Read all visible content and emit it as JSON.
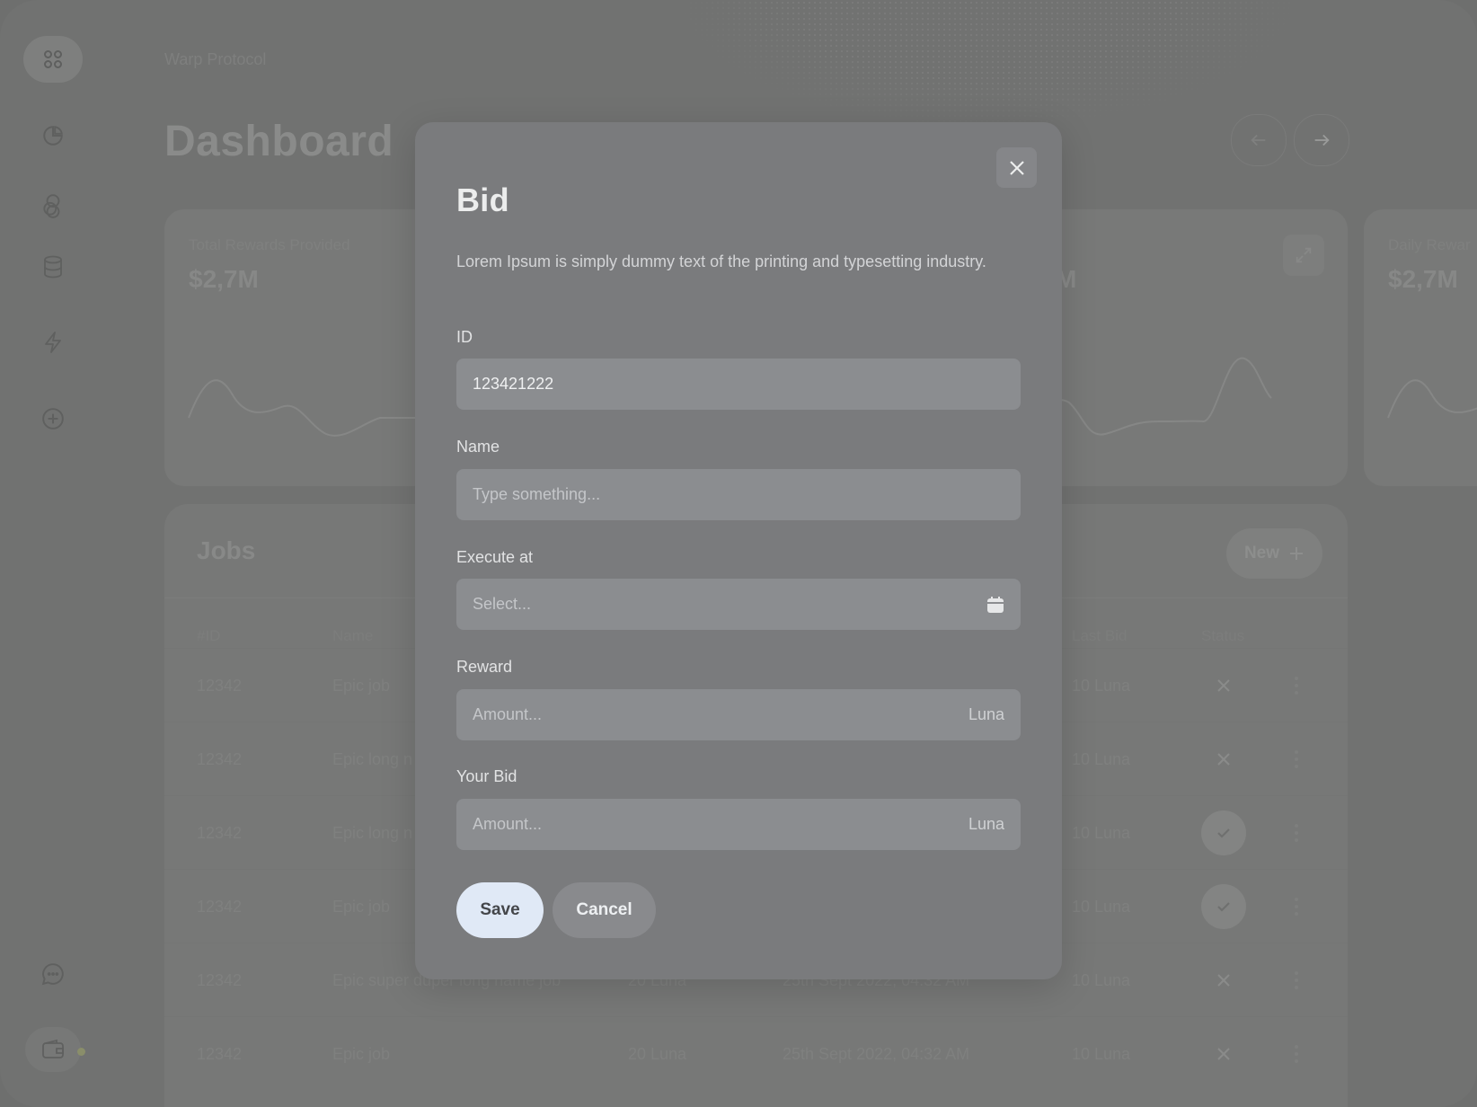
{
  "app": {
    "breadcrumb": "Warp Protocol",
    "title": "Dashboard"
  },
  "sidebar": {
    "icons": [
      "grid-icon",
      "pie-chart-icon",
      "overlap-circles-icon",
      "database-icon",
      "lightning-icon",
      "plus-circle-icon",
      "chat-icon",
      "wallet-icon"
    ]
  },
  "stats": [
    {
      "label": "Total Rewards Provided",
      "value": "$2,7M"
    },
    {
      "label": "",
      "value": "M"
    },
    {
      "label": "Daily Rewar",
      "value": "$2,7M"
    }
  ],
  "jobs": {
    "title": "Jobs",
    "new_label": "New",
    "columns": {
      "id": "#ID",
      "name": "Name",
      "last_bid": "Last Bid",
      "status": "Status"
    },
    "rows": [
      {
        "id": "12342",
        "name": "Epic job",
        "reward": "",
        "date": "",
        "last_bid": "10 Luna",
        "status": "failed"
      },
      {
        "id": "12342",
        "name": "Epic long n",
        "reward": "",
        "date": "",
        "last_bid": "10 Luna",
        "status": "failed"
      },
      {
        "id": "12342",
        "name": "Epic long n",
        "reward": "",
        "date": "",
        "last_bid": "10 Luna",
        "status": "done"
      },
      {
        "id": "12342",
        "name": "Epic job",
        "reward": "",
        "date": "",
        "last_bid": "10 Luna",
        "status": "done"
      },
      {
        "id": "12342",
        "name": "Epic super duper long name job",
        "reward": "20 Luna",
        "date": "25th Sept 2022, 04:32 AM",
        "last_bid": "10 Luna",
        "status": "failed"
      },
      {
        "id": "12342",
        "name": "Epic job",
        "reward": "20 Luna",
        "date": "25th Sept 2022, 04:32 AM",
        "last_bid": "10 Luna",
        "status": "failed"
      }
    ]
  },
  "modal": {
    "title": "Bid",
    "description": "Lorem Ipsum is simply dummy text of the printing and typesetting industry.",
    "fields": {
      "id": {
        "label": "ID",
        "value": "123421222"
      },
      "name": {
        "label": "Name",
        "placeholder": "Type something..."
      },
      "execute_at": {
        "label": "Execute at",
        "placeholder": "Select..."
      },
      "reward": {
        "label": "Reward",
        "placeholder": "Amount...",
        "suffix": "Luna"
      },
      "your_bid": {
        "label": "Your Bid",
        "placeholder": "Amount...",
        "suffix": "Luna"
      }
    },
    "save_label": "Save",
    "cancel_label": "Cancel"
  },
  "colors": {
    "overlay": "#717271",
    "modal_bg": "#7a7b7d",
    "input_bg": "#8b8d90",
    "save_bg": "#e0e9f6"
  }
}
